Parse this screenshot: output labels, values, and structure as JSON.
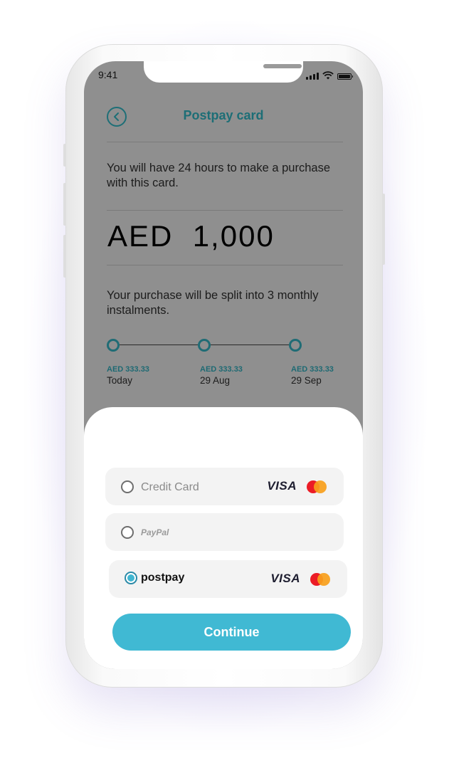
{
  "status_bar": {
    "time": "9:41"
  },
  "header": {
    "title": "Postpay card",
    "back_icon": "chevron-left-circle-icon"
  },
  "info": {
    "time_limit_text": "You will have 24 hours to make a purchase with this card."
  },
  "amount": {
    "value": "AED  1,000"
  },
  "split": {
    "text": "Your purchase will be split into 3 monthly instalments.",
    "instalments": [
      {
        "amount": "AED 333.33",
        "date": "Today"
      },
      {
        "amount": "AED 333.33",
        "date": "29 Aug"
      },
      {
        "amount": "AED 333.33",
        "date": "29 Sep"
      }
    ]
  },
  "payment_options": [
    {
      "label": "Credit Card",
      "selected": false,
      "visa": "VISA"
    },
    {
      "label": "PayPal",
      "selected": false
    },
    {
      "label": "postpay",
      "selected": true,
      "visa": "VISA"
    }
  ],
  "continue_label": "Continue",
  "colors": {
    "accent": "#40b9d3",
    "teal_dark": "#1d6e76",
    "overlay_gray": "#8f8f8f",
    "mastercard_red": "#eb1c26",
    "mastercard_yellow": "#f99f1b"
  }
}
